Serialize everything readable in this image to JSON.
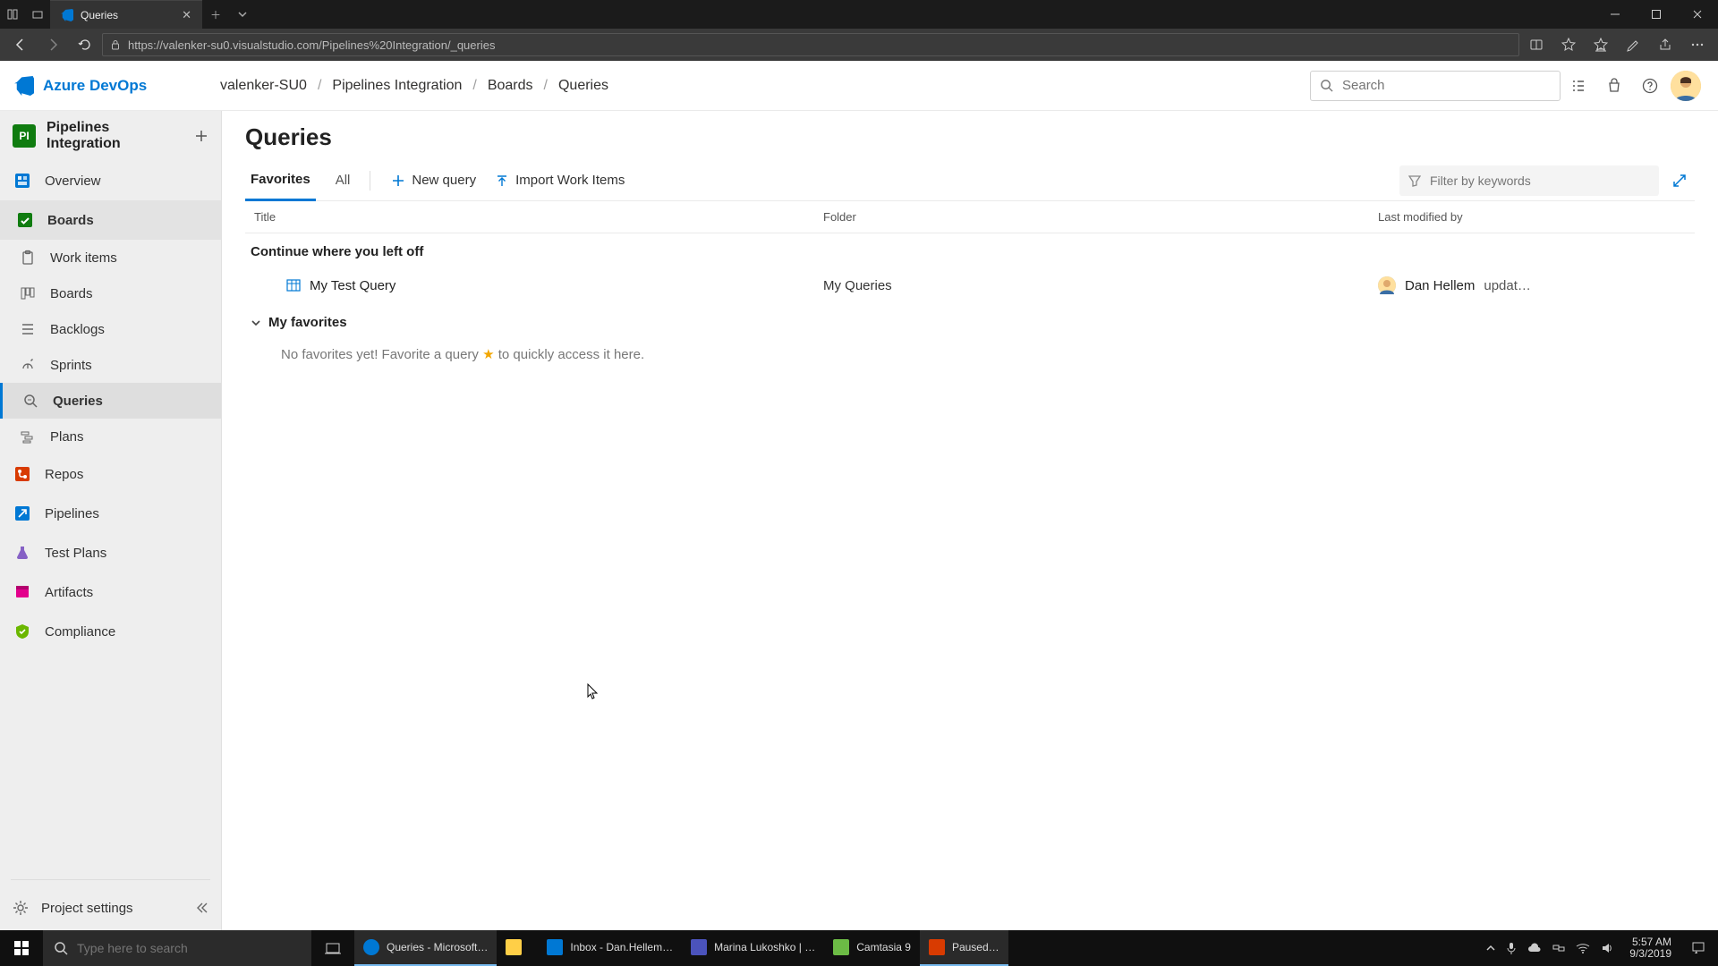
{
  "browser": {
    "tab_title": "Queries",
    "url": "https://valenker-su0.visualstudio.com/Pipelines%20Integration/_queries"
  },
  "header": {
    "product": "Azure DevOps",
    "breadcrumbs": [
      "valenker-SU0",
      "Pipelines Integration",
      "Boards",
      "Queries"
    ],
    "search_placeholder": "Search"
  },
  "sidebar": {
    "project_badge": "PI",
    "project_name": "Pipelines Integration",
    "items": [
      {
        "label": "Overview"
      },
      {
        "label": "Boards"
      },
      {
        "label": "Work items"
      },
      {
        "label": "Boards"
      },
      {
        "label": "Backlogs"
      },
      {
        "label": "Sprints"
      },
      {
        "label": "Queries"
      },
      {
        "label": "Plans"
      },
      {
        "label": "Repos"
      },
      {
        "label": "Pipelines"
      },
      {
        "label": "Test Plans"
      },
      {
        "label": "Artifacts"
      },
      {
        "label": "Compliance"
      }
    ],
    "settings_label": "Project settings"
  },
  "page": {
    "title": "Queries",
    "tabs": {
      "favorites": "Favorites",
      "all": "All"
    },
    "commands": {
      "new_query": "New query",
      "import": "Import Work Items"
    },
    "filter_placeholder": "Filter by keywords",
    "columns": {
      "title": "Title",
      "folder": "Folder",
      "modified": "Last modified by"
    },
    "continue_section": "Continue where you left off",
    "recent_query": {
      "title": "My Test Query",
      "folder": "My Queries",
      "modified_by": "Dan Hellem",
      "modified_suffix": "updat…"
    },
    "favorites_section": "My favorites",
    "favorites_empty_pre": "No favorites yet! Favorite a query ",
    "favorites_empty_post": " to quickly access it here."
  },
  "taskbar": {
    "search_placeholder": "Type here to search",
    "apps": [
      {
        "label": "Queries - Microsoft…",
        "color": "#0078d4"
      },
      {
        "label": "",
        "color": "#ffcf47"
      },
      {
        "label": "Inbox - Dan.Hellem…",
        "color": "#0078d4"
      },
      {
        "label": "Marina Lukoshko | …",
        "color": "#4b53bc"
      },
      {
        "label": "Camtasia 9",
        "color": "#6cbb45"
      },
      {
        "label": "Paused…",
        "color": "#d83b01"
      }
    ],
    "time": "5:57 AM",
    "date": "9/3/2019"
  }
}
